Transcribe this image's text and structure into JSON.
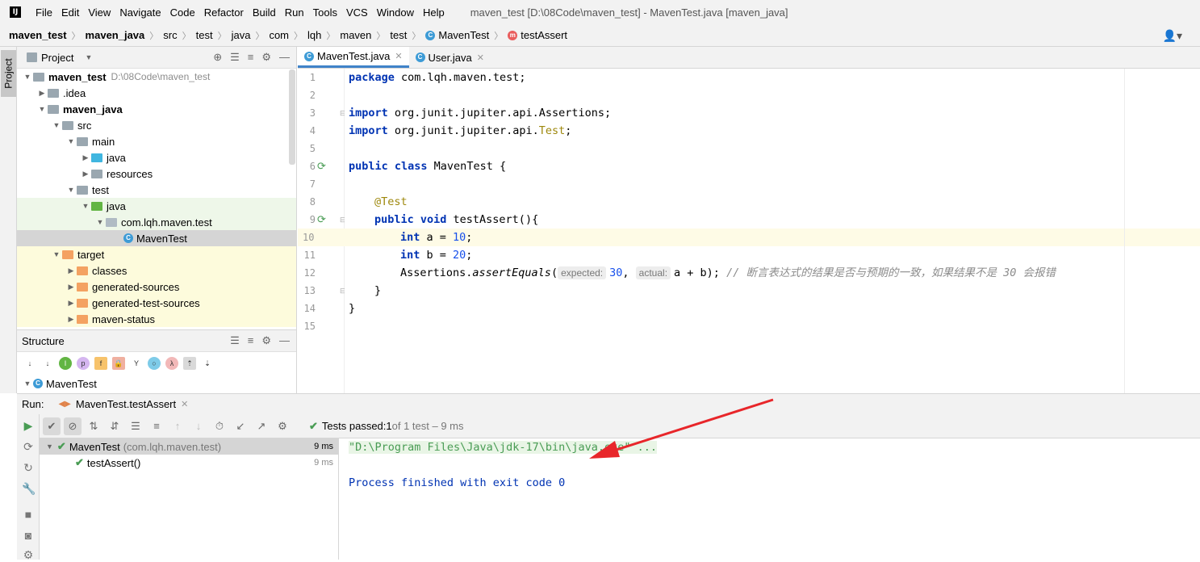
{
  "app": {
    "logo": "IJ"
  },
  "menu": {
    "items": [
      "File",
      "Edit",
      "View",
      "Navigate",
      "Code",
      "Refactor",
      "Build",
      "Run",
      "Tools",
      "VCS",
      "Window",
      "Help"
    ],
    "window_title": "maven_test [D:\\08Code\\maven_test] - MavenTest.java [maven_java]"
  },
  "breadcrumbs": [
    "maven_test",
    "maven_java",
    "src",
    "test",
    "java",
    "com",
    "lqh",
    "maven",
    "test",
    "MavenTest",
    "testAssert"
  ],
  "sidebar": {
    "project_tab": "Project"
  },
  "project_panel": {
    "title": "Project",
    "tree": [
      {
        "label": "maven_test",
        "path": "D:\\08Code\\maven_test"
      },
      {
        "label": ".idea"
      },
      {
        "label": "maven_java"
      },
      {
        "label": "src"
      },
      {
        "label": "main"
      },
      {
        "label": "java"
      },
      {
        "label": "resources"
      },
      {
        "label": "test"
      },
      {
        "label": "java"
      },
      {
        "label": "com.lqh.maven.test"
      },
      {
        "label": "MavenTest"
      },
      {
        "label": "target"
      },
      {
        "label": "classes"
      },
      {
        "label": "generated-sources"
      },
      {
        "label": "generated-test-sources"
      },
      {
        "label": "maven-status"
      }
    ]
  },
  "structure_panel": {
    "title": "Structure",
    "root": "MavenTest"
  },
  "editor": {
    "tabs": [
      {
        "label": "MavenTest.java",
        "active": true
      },
      {
        "label": "User.java",
        "active": false
      }
    ],
    "line_numbers": [
      "1",
      "2",
      "3",
      "4",
      "5",
      "6",
      "7",
      "8",
      "9",
      "10",
      "11",
      "12",
      "13",
      "14",
      "15"
    ],
    "code": {
      "l1_kw": "package",
      "l1_rest": " com.lqh.maven.test;",
      "l3_kw": "import",
      "l3_rest": " org.junit.jupiter.api.Assertions;",
      "l4_kw": "import",
      "l4_rest": " org.junit.jupiter.api.",
      "l4_cls": "Test",
      "l4_end": ";",
      "l6_kw": "public class",
      "l6_rest": " MavenTest {",
      "l8_ann": "@Test",
      "l9_kw": "public void",
      "l9_rest": " testAssert(){",
      "l10_kw": "int",
      "l10_rest": " a = ",
      "l10_num": "10",
      "l10_end": ";",
      "l11_kw": "int",
      "l11_rest": " b = ",
      "l11_num": "20",
      "l11_end": ";",
      "l12_pre": "Assertions.",
      "l12_method": "assertEquals",
      "l12_paren": "(",
      "l12_hint1": "expected:",
      "l12_num": "30",
      "l12_comma": ", ",
      "l12_hint2": "actual:",
      "l12_rest": "a + b); ",
      "l12_comment": "// 断言表达式的结果是否与预期的一致，如果结果不是 30 会报错",
      "l13": "}",
      "l14": "}"
    }
  },
  "run_panel": {
    "label": "Run:",
    "config": "MavenTest.testAssert",
    "status_prefix": "Tests passed: ",
    "status_count": "1",
    "status_suffix": " of 1 test – 9 ms",
    "tests": [
      {
        "name": "MavenTest",
        "pkg": "(com.lqh.maven.test)",
        "time": "9 ms"
      },
      {
        "name": "testAssert()",
        "time": "9 ms"
      }
    ],
    "console": [
      "\"D:\\Program Files\\Java\\jdk-17\\bin\\java.exe\" ...",
      "Process finished with exit code 0"
    ]
  },
  "colors": {
    "accent": "#4083c9",
    "success": "#499c54",
    "arrow": "#e8262a"
  }
}
